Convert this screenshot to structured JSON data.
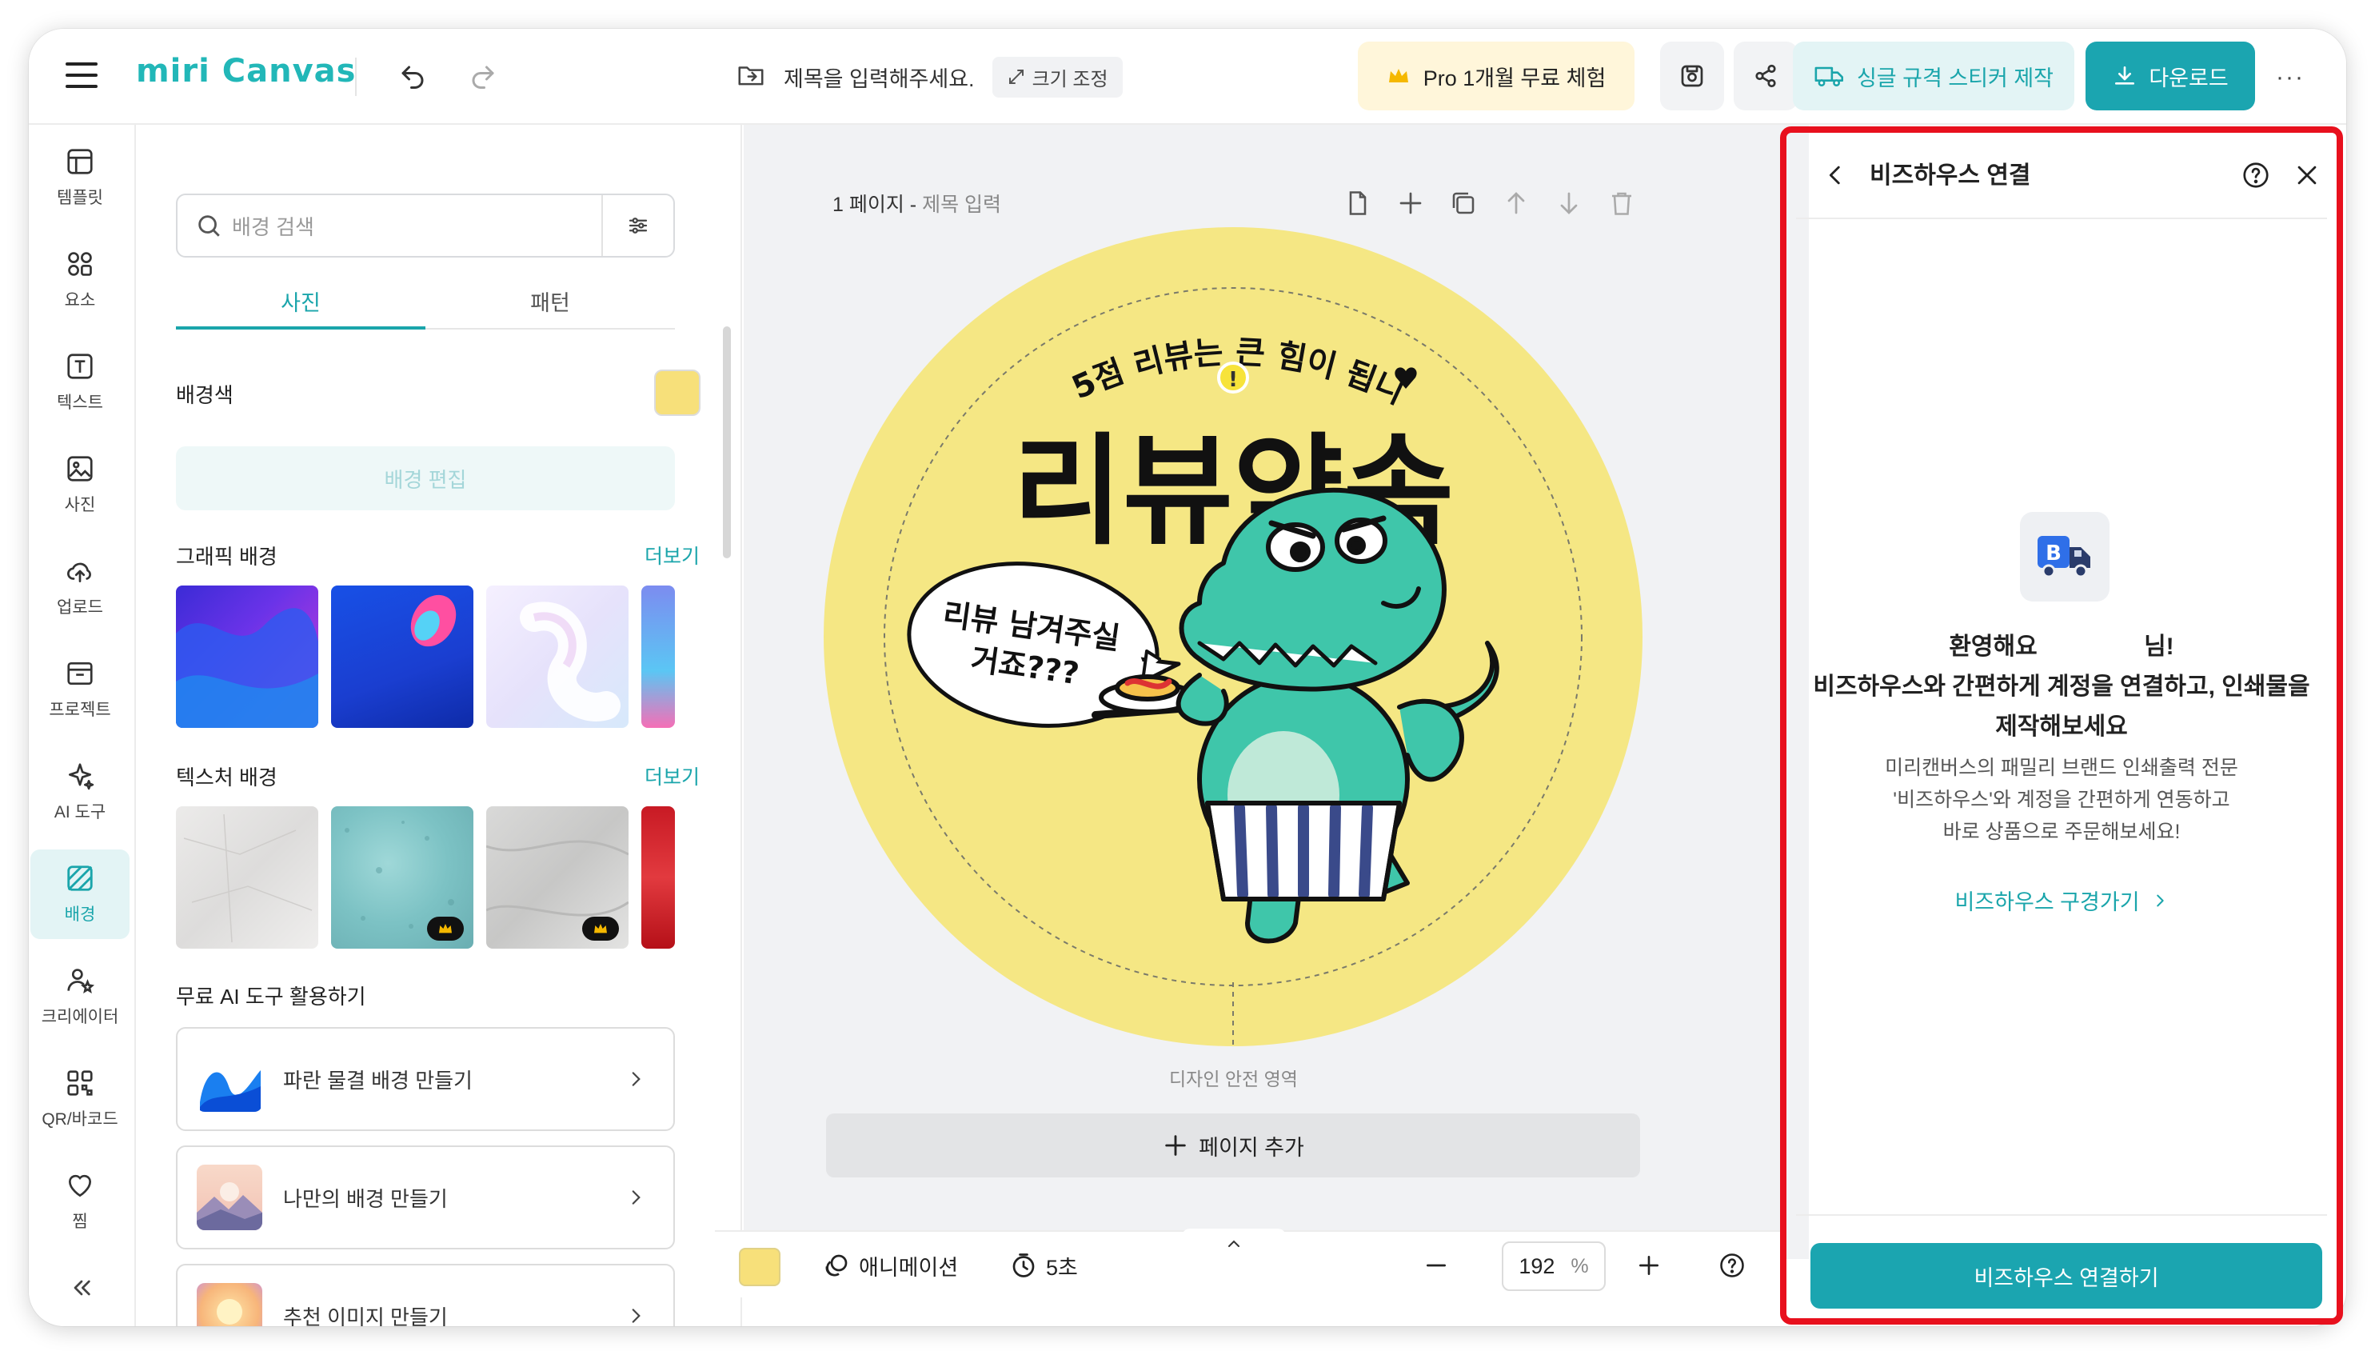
{
  "header": {
    "logo": "miri Canvas",
    "doc_title": "제목을 입력해주세요.",
    "resize_label": "크기 조정",
    "pro_trial_label": "Pro 1개월 무료 체험",
    "sticker_label": "싱글 규격 스티커 제작",
    "download_label": "다운로드",
    "more_label": "···"
  },
  "rail": {
    "items": [
      {
        "label": "템플릿",
        "icon": "template-icon"
      },
      {
        "label": "요소",
        "icon": "elements-icon"
      },
      {
        "label": "텍스트",
        "icon": "text-icon"
      },
      {
        "label": "사진",
        "icon": "photo-icon"
      },
      {
        "label": "업로드",
        "icon": "upload-icon"
      },
      {
        "label": "프로젝트",
        "icon": "project-icon"
      },
      {
        "label": "AI 도구",
        "icon": "ai-tool-icon"
      },
      {
        "label": "배경",
        "icon": "background-icon",
        "active": true
      },
      {
        "label": "크리에이터",
        "icon": "creator-icon"
      },
      {
        "label": "QR/바코드",
        "icon": "qr-icon"
      },
      {
        "label": "찜",
        "icon": "heart-icon"
      }
    ]
  },
  "panel": {
    "search_placeholder": "배경 검색",
    "tabs": [
      "사진",
      "패턴"
    ],
    "active_tab": "사진",
    "bg_color_label": "배경색",
    "bg_color": "#f7e07a",
    "bg_edit_label": "배경 편집",
    "graphic_title": "그래픽 배경",
    "texture_title": "텍스처 배경",
    "more_link": "더보기",
    "ai_title": "무료 AI 도구 활용하기",
    "ai_cards": [
      {
        "label": "파란 물결 배경 만들기"
      },
      {
        "label": "나만의 배경 만들기"
      },
      {
        "label": "추천 이미지 만들기"
      }
    ]
  },
  "canvas": {
    "page_label": "1 페이지 - ",
    "page_sub": "제목 입력",
    "design": {
      "top_text": "별 5점 리뷰는 큰 힘이 됩니다",
      "heading": "리뷰약속",
      "bubble_line1": "리뷰 남겨주실",
      "bubble_line2": "거죠???",
      "circle_color": "#f5e784"
    },
    "safe_area_label": "디자인 안전 영역",
    "add_page_label": "페이지 추가"
  },
  "bottom_bar": {
    "animation_label": "애니메이션",
    "duration_label": "5초",
    "zoom_value": "192",
    "zoom_unit": "%"
  },
  "right_panel": {
    "title": "비즈하우스 연결",
    "welcome_line1": "환영해요                님!",
    "welcome_line2": "비즈하우스와 간편하게 계정을 연결하고, 인쇄물을",
    "welcome_line3": "제작해보세요",
    "desc_line1": "미리캔버스의 패밀리 브랜드 인쇄출력 전문",
    "desc_line2": "'비즈하우스'와 계정을 간편하게 연동하고",
    "desc_line3": "바로 상품으로 주문해보세요!",
    "link_label": "비즈하우스 구경가기",
    "connect_label": "비즈하우스 연결하기",
    "highlight_color": "#e8101d"
  },
  "colors": {
    "accent": "#1ba5b0",
    "pro_bg": "#fff6da"
  }
}
